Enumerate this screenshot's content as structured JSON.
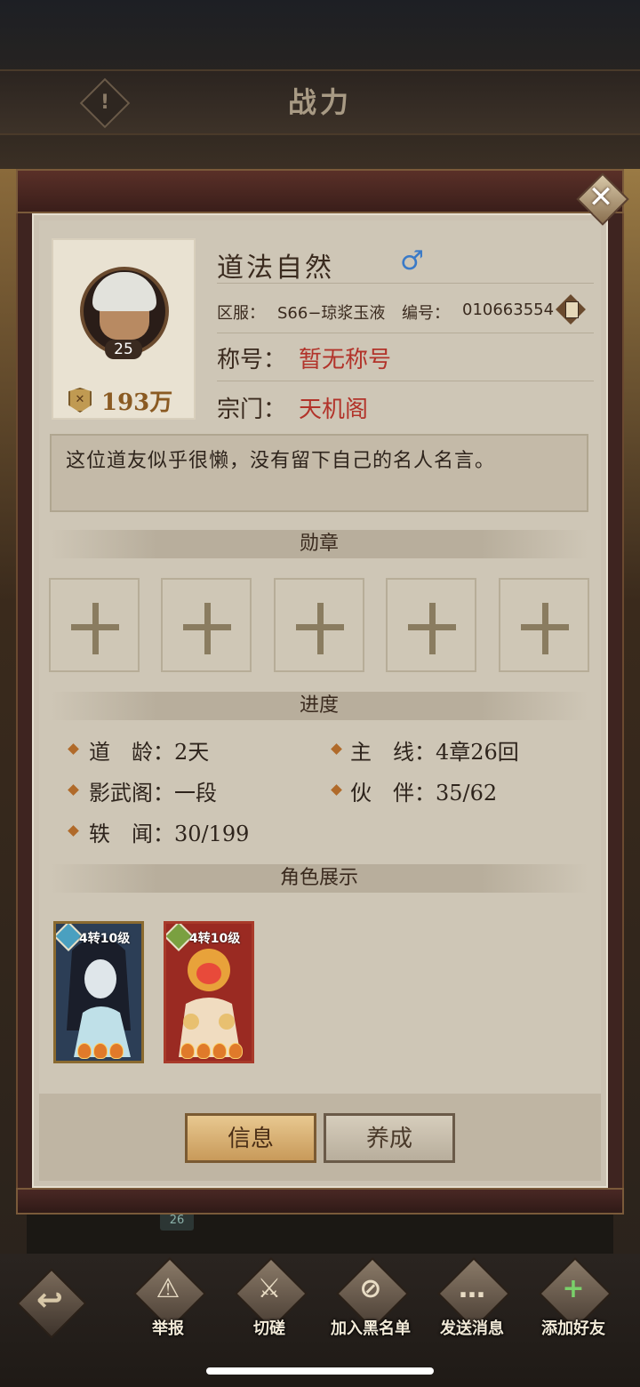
{
  "header": {
    "title": "战力",
    "warning_glyph": "!"
  },
  "background": {
    "level_tag": "26"
  },
  "dialog": {
    "close_glyph": "✕"
  },
  "profile": {
    "name": "道法自然",
    "gender_symbol": "♂",
    "server_label": "区服：",
    "server_value": "S66−琼浆玉液",
    "id_label": "编号：",
    "id_value": "010663554",
    "title_label": "称号：",
    "title_value": "暂无称号",
    "sect_label": "宗门：",
    "sect_value": "天机阁",
    "avatar_level": "25",
    "power_value": "193万",
    "quote": "这位道友似乎很懒，没有留下自己的名人名言。"
  },
  "sections": {
    "medals": "勋章",
    "progress": "进度",
    "showcase": "角色展示"
  },
  "progress": [
    {
      "label": "道　龄：",
      "value": "2天"
    },
    {
      "label": "主　线：",
      "value": "4章26回"
    },
    {
      "label": "影武阁：",
      "value": "一段"
    },
    {
      "label": "伙　伴：",
      "value": "35/62"
    },
    {
      "label": "轶　闻：",
      "value": "30/199"
    }
  ],
  "heroes": [
    {
      "level_text": "4转10级",
      "stars": 3,
      "bg": "#2c3e56",
      "accent": "#7ab8d8"
    },
    {
      "level_text": "4转10级",
      "stars": 4,
      "bg": "#9a2a22",
      "accent": "#e8c070"
    }
  ],
  "tabs": {
    "info": "信息",
    "train": "养成"
  },
  "actions": {
    "back_glyph": "↩",
    "report": "举报",
    "spar": "切磋",
    "blacklist": "加入黑名单",
    "message": "发送消息",
    "add_friend": "添加好友"
  }
}
